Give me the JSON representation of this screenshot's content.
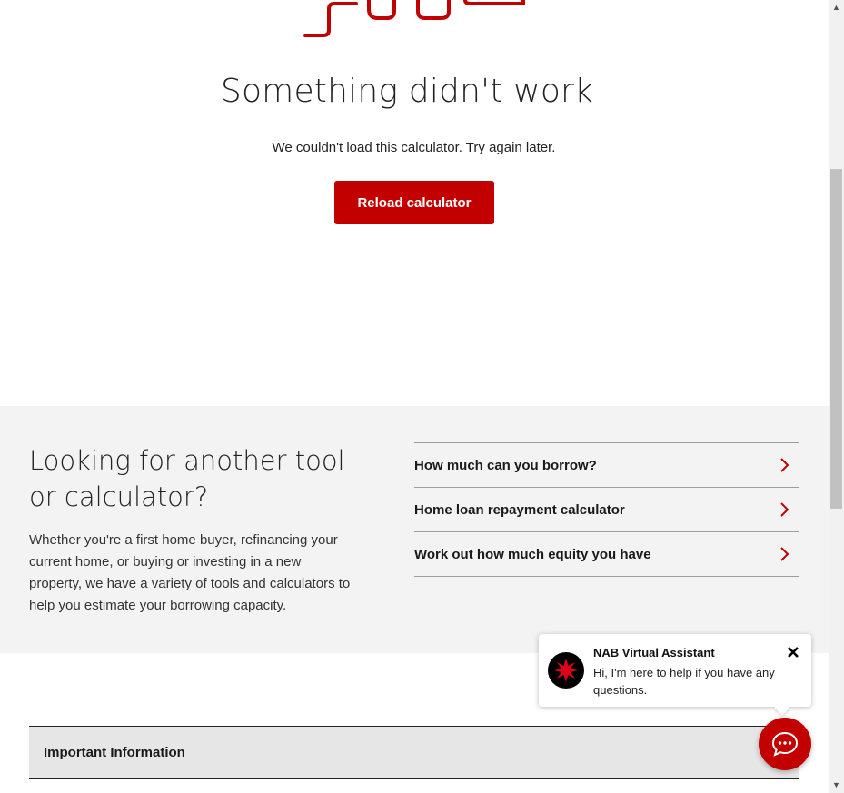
{
  "error": {
    "title": "Something didn't work",
    "message": "We couldn't load this calculator. Try again later.",
    "reload_label": "Reload calculator"
  },
  "tools": {
    "heading": "Looking for another tool or calculator?",
    "description": "Whether you're a first home buyer, refinancing your current home, or buying or investing in a new property, we have a variety of tools and calculators to help you estimate your borrowing capacity.",
    "links": [
      {
        "label": "How much can you borrow?"
      },
      {
        "label": "Home loan repayment calculator"
      },
      {
        "label": "Work out how much equity you have"
      }
    ]
  },
  "important_info": {
    "label": "Important Information"
  },
  "chat": {
    "name": "NAB Virtual Assistant",
    "message": "Hi, I'm here to help if you have any questions."
  },
  "colors": {
    "brand_red": "#c20000",
    "section_bg": "#f3f3f3"
  },
  "icons": {
    "chevron": "chevron-right-icon",
    "close": "close-icon",
    "chat": "chat-bubble-icon",
    "avatar": "nab-star-icon"
  }
}
